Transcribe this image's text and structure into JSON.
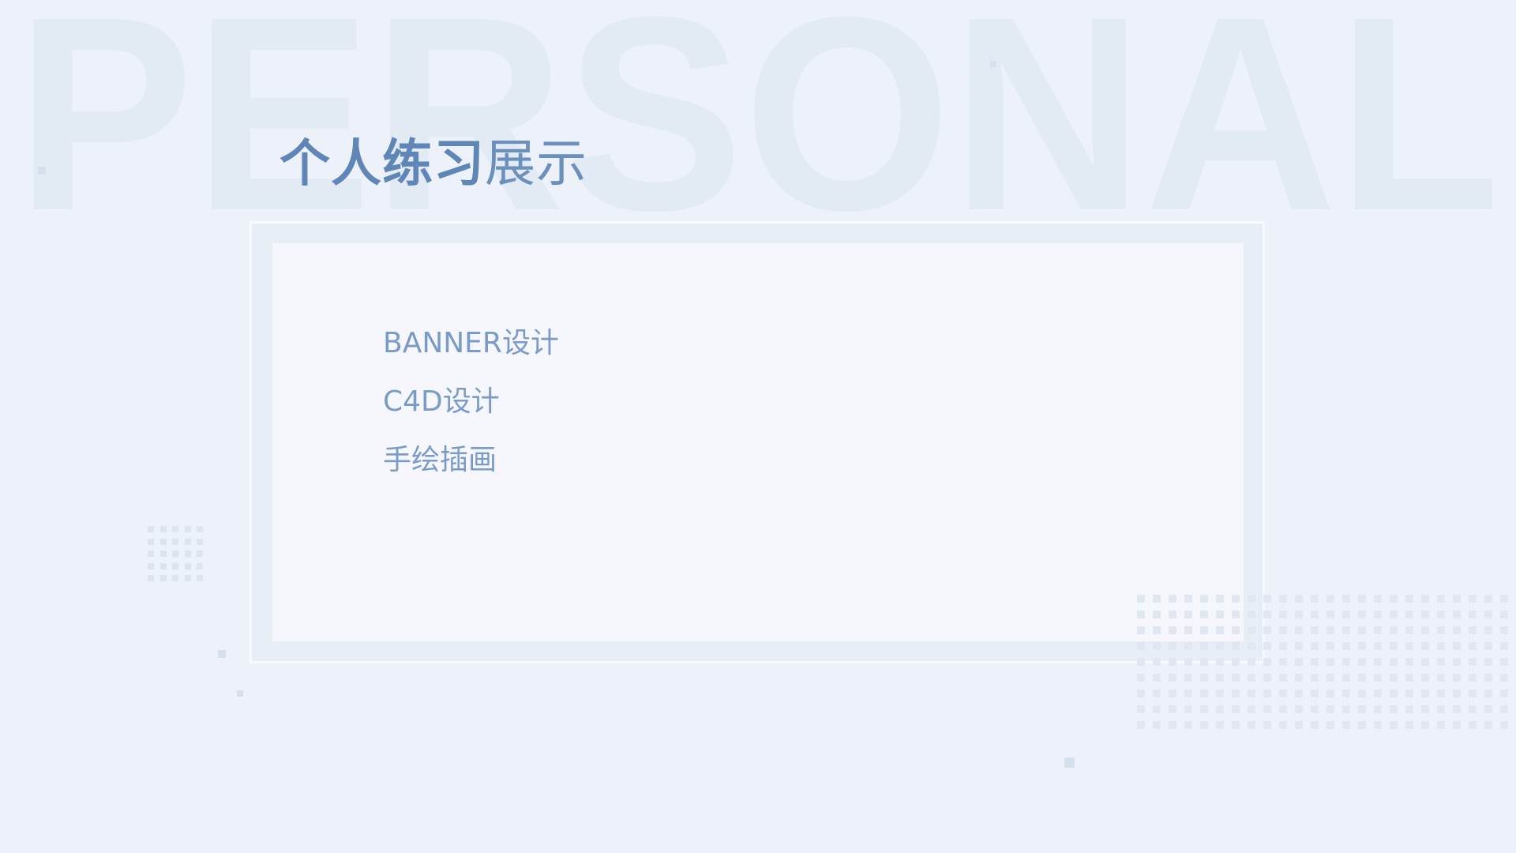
{
  "watermark": {
    "text": "PERSONAL"
  },
  "title": {
    "bold_part": "个人练习",
    "light_part": "展示"
  },
  "menu": {
    "items": [
      {
        "label": "BANNER设计"
      },
      {
        "label": "C4D设计"
      },
      {
        "label": "手绘插画"
      }
    ]
  },
  "colors": {
    "background": "#edf2fa",
    "panel": "#f5f7fd",
    "title_accent": "#5f86b7",
    "menu_text": "#7a9bc7",
    "watermark": "#e2eaf3"
  }
}
